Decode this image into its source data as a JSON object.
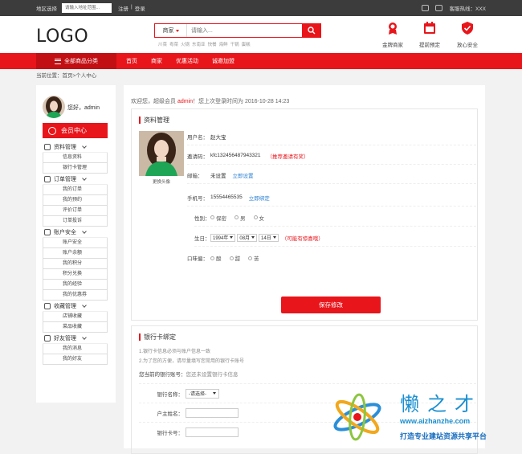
{
  "topbar": {
    "region_label": "地区选择",
    "region_placeholder": "请输入地址范围...",
    "register": "注册",
    "separator": "|",
    "login": "登录",
    "hotline_label": "客服热线：",
    "hotline_value": "XXX"
  },
  "header": {
    "logo": "LOGO",
    "search": {
      "category": "商家",
      "placeholder": "请输入..."
    },
    "hotwords": [
      "川菜",
      "粤菜",
      "火锅",
      "东南亚",
      "快餐",
      "海鲜",
      "干锅",
      "蛋糕"
    ],
    "features": [
      "金牌商家",
      "提前预定",
      "放心安全"
    ]
  },
  "nav": {
    "all_categories": "全部商品分类",
    "links": [
      "首页",
      "商家",
      "优惠活动",
      "诚邀加盟"
    ]
  },
  "breadcrumb": "当前位置：首页>个人中心",
  "sidebar": {
    "greeting": "您好，admin",
    "member_center": "会员中心",
    "groups": [
      {
        "title": "资料管理",
        "icon": "gear-icon",
        "items": [
          "信息资料",
          "银行卡管理"
        ]
      },
      {
        "title": "订单管理",
        "icon": "list-icon",
        "items": [
          "我的订单",
          "我的预约",
          "评价订单",
          "订单投诉"
        ]
      },
      {
        "title": "账户安全",
        "icon": "account-icon",
        "items": [
          "账户安全",
          "账户余额",
          "我的积分",
          "积分兑换",
          "我的经验",
          "我的优惠券"
        ]
      },
      {
        "title": "收藏管理",
        "icon": "heart-icon",
        "items": [
          "店铺收藏",
          "菜品收藏"
        ]
      },
      {
        "title": "好友管理",
        "icon": "friend-icon",
        "items": [
          "我的消息",
          "我的好友"
        ]
      }
    ]
  },
  "welcome": {
    "prefix": "欢迎您，超级会员",
    "name": "admin",
    "suffix": "！您上次登录时间为 2016-10-28 14:23"
  },
  "profile": {
    "title": "资料管理",
    "change_avatar": "更换头像",
    "username_label": "用户名：",
    "username": "赵大宝",
    "invite_label": "邀请码：",
    "invite_code": "kfc132456487943321",
    "invite_hint": "（推荐邀请有奖）",
    "email_label": "邮箱：",
    "email_value": "未设置",
    "email_link": "立即设置",
    "phone_label": "手机号：",
    "phone": "15554465535",
    "phone_link": "立即绑定",
    "gender_label": "性别：",
    "gender_options": [
      "保密",
      "男",
      "女"
    ],
    "birthday_label": "生日：",
    "birth_year": "1994年",
    "birth_month": "08月",
    "birth_day": "14日",
    "birthday_hint": "（可能有惊喜哦）",
    "taste_label": "口味偏：",
    "taste_options": [
      "酸",
      "甜",
      "苦"
    ],
    "save": "保存修改"
  },
  "bank": {
    "title": "银行卡绑定",
    "info1": "1.银行卡信息必须与账户信息一致",
    "info2": "2.为了您的方便，请尽量填写您常用的银行卡账号",
    "current_label": "您当前的银行账号：",
    "current_value": "您还未设置银行卡信息",
    "bank_name_label": "银行名称：",
    "bank_name_select": "-请选择-",
    "holder_label": "户主姓名：",
    "card_label": "银行卡号："
  },
  "watermark": {
    "brand": "懒之才",
    "url": "www.aizhanzhe.com",
    "slogan": "打造专业建站资源共享平台"
  },
  "colors": {
    "accent": "#e8151b",
    "link": "#2a7fd0",
    "topbar": "#3c3c3c"
  }
}
